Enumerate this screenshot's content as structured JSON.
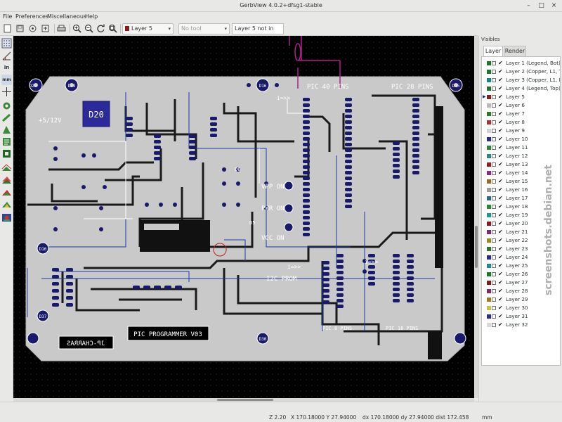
{
  "window": {
    "title": "GerbView 4.0.2+dfsg1-stable",
    "minimize_glyph": "–",
    "maximize_glyph": "□",
    "close_glyph": "×"
  },
  "menu": {
    "items": [
      "File",
      "Preferences",
      "Miscellaneous",
      "Help"
    ]
  },
  "toolbar": {
    "layer_select": "Layer 5",
    "tool_select": "No tool",
    "layer_status": "Layer 5 not in use",
    "layer_color": "#8a1c1c"
  },
  "left_tools": [
    "grid-icon",
    "polar-icon",
    "inch-units-icon",
    "mm-units-icon",
    "cursor-icon",
    "flash-icon",
    "lines-icon",
    "polygon-icon",
    "dcode-icon",
    "negative-icon",
    "layer-view-icon",
    "layers-icon",
    "diff-icon",
    "layers2-icon",
    "highcontrast-icon"
  ],
  "canvas": {
    "silk": {
      "d29": "D29",
      "d39": "D39",
      "d20": "D20",
      "d16a": "D16",
      "d16b": "D16",
      "d15": "D15",
      "d37": "D37",
      "d30": "D30",
      "v12": "+5/12V",
      "pic40": "PIC 40 PINS",
      "pic28": "PIC 28 PINS",
      "vpp": "VPP ON",
      "pwr": "PWR ON",
      "vcc": "VCC ON",
      "i2c": "I2C PROM",
      "i1": "i=>>",
      "i2": "i=>>",
      "i3": "i=>>",
      "picprog": "PIC PROGRAMMER V03",
      "pcharr": "JP-CHARRAS",
      "d6": "D6",
      "d5": "D5",
      "d7": "D7",
      "d8": "D8",
      "pic8": "PIC 8 PINS",
      "pic18": "PIC 18 PINS"
    }
  },
  "panel": {
    "title": "Visibles",
    "tabs": [
      "Layer",
      "Render"
    ],
    "layers": [
      {
        "name": "Layer 1 (Legend, Bot)",
        "color": "#1e7a2a",
        "visible": true,
        "current": false
      },
      {
        "name": "Layer 2 (Copper, L1, To",
        "color": "#1e7a2a",
        "visible": true,
        "current": false
      },
      {
        "name": "Layer 3 (Copper, L1, Bc",
        "color": "#0b8a8a",
        "visible": true,
        "current": false
      },
      {
        "name": "Layer 4 (Legend, Top)",
        "color": "#1e7a2a",
        "visible": true,
        "current": false
      },
      {
        "name": "Layer 5",
        "color": "#8a1c1c",
        "visible": true,
        "current": true
      },
      {
        "name": "Layer 6",
        "color": "#b8b8b8",
        "visible": true,
        "current": false
      },
      {
        "name": "Layer 7",
        "color": "#2a7a2a",
        "visible": true,
        "current": false
      },
      {
        "name": "Layer 8",
        "color": "#b03030",
        "visible": true,
        "current": false
      },
      {
        "name": "Layer 9",
        "color": "#d0d0d0",
        "visible": true,
        "current": false
      },
      {
        "name": "Layer 10",
        "color": "#2a2a9a",
        "visible": true,
        "current": false
      },
      {
        "name": "Layer 11",
        "color": "#2a8a2a",
        "visible": true,
        "current": false
      },
      {
        "name": "Layer 12",
        "color": "#1a8a8a",
        "visible": true,
        "current": false
      },
      {
        "name": "Layer 13",
        "color": "#9a1a1a",
        "visible": true,
        "current": false
      },
      {
        "name": "Layer 14",
        "color": "#8a2a8a",
        "visible": true,
        "current": false
      },
      {
        "name": "Layer 15",
        "color": "#9a6a1a",
        "visible": true,
        "current": false
      },
      {
        "name": "Layer 16",
        "color": "#a0a0a0",
        "visible": true,
        "current": false
      },
      {
        "name": "Layer 17",
        "color": "#2a6a8a",
        "visible": true,
        "current": false
      },
      {
        "name": "Layer 18",
        "color": "#2a8a2a",
        "visible": true,
        "current": false
      },
      {
        "name": "Layer 19",
        "color": "#1a9a9a",
        "visible": true,
        "current": false
      },
      {
        "name": "Layer 20",
        "color": "#8a1a1a",
        "visible": true,
        "current": false
      },
      {
        "name": "Layer 21",
        "color": "#7a2a7a",
        "visible": true,
        "current": false
      },
      {
        "name": "Layer 22",
        "color": "#9a8a1a",
        "visible": true,
        "current": false
      },
      {
        "name": "Layer 23",
        "color": "#2a7a2a",
        "visible": true,
        "current": false
      },
      {
        "name": "Layer 24",
        "color": "#2a2a9a",
        "visible": true,
        "current": false
      },
      {
        "name": "Layer 25",
        "color": "#1a8a8a",
        "visible": true,
        "current": false
      },
      {
        "name": "Layer 26",
        "color": "#1a7a2a",
        "visible": true,
        "current": false
      },
      {
        "name": "Layer 27",
        "color": "#8a1a1a",
        "visible": true,
        "current": false
      },
      {
        "name": "Layer 28",
        "color": "#7a2a7a",
        "visible": true,
        "current": false
      },
      {
        "name": "Layer 29",
        "color": "#a07a1a",
        "visible": true,
        "current": false
      },
      {
        "name": "Layer 30",
        "color": "#c8c040",
        "visible": true,
        "current": false
      },
      {
        "name": "Layer 31",
        "color": "#2a2a9a",
        "visible": true,
        "current": false
      },
      {
        "name": "Layer 32",
        "color": "#d8d8d8",
        "visible": true,
        "current": false
      }
    ]
  },
  "status": {
    "zoom": "Z 2.20",
    "abs": "X 170.18000  Y 27.94000",
    "rel": "dx 170.18000  dy 27.94000  dist 172.458",
    "units": "mm"
  },
  "watermark": "screenshots.debian.net"
}
